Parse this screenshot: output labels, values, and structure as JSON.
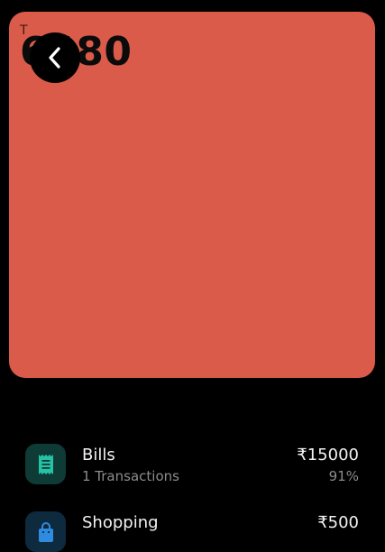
{
  "header": {
    "caption": "T",
    "total_amount": "6480"
  },
  "colors": {
    "hero_background": "#DA5B4A",
    "bills_icon_bg": "#0E3B36",
    "bills_icon_fg": "#27C2A6",
    "shopping_icon_bg": "#0E2A3E",
    "shopping_icon_fg": "#2F8BE0"
  },
  "categories": [
    {
      "name": "Bills",
      "icon": "receipt-icon",
      "transactions": "1 Transactions",
      "amount": "₹15000",
      "percent": "91%"
    },
    {
      "name": "Shopping",
      "icon": "shopping-bag-icon",
      "transactions": "",
      "amount": "₹500",
      "percent": ""
    }
  ]
}
